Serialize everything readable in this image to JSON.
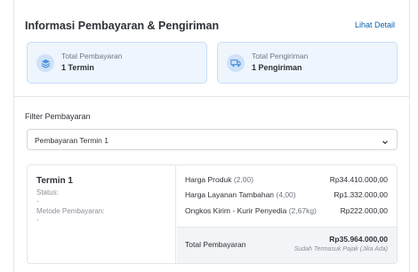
{
  "header": {
    "title": "Informasi Pembayaran & Pengiriman",
    "link": "Lihat Detail"
  },
  "summary": {
    "payment": {
      "label": "Total Pembayaran",
      "value": "1 Termin",
      "icon": "stack-icon"
    },
    "shipping": {
      "label": "Total Pengiriman",
      "value": "1 Pengiriman",
      "icon": "truck-icon"
    }
  },
  "filter": {
    "label": "Filter Pembayaran",
    "selected": "Pembayaran Termin 1"
  },
  "detail": {
    "termin_title": "Termin 1",
    "status_label": "Status:",
    "status_value": "-",
    "method_label": "Metode Pembayaran:",
    "method_value": "-",
    "lines": [
      {
        "label": "Harga Produk",
        "qty": "(2,00)",
        "amount": "Rp34.410.000,00"
      },
      {
        "label": "Harga Layanan Tambahan",
        "qty": "(4,00)",
        "amount": "Rp1.332.000,00"
      },
      {
        "label": "Ongkos Kirim - Kurir Penyedia",
        "qty": "(2,67kg)",
        "amount": "Rp222.000,00"
      }
    ],
    "total_label": "Total Pembayaran",
    "total_amount": "Rp35.964.000,00",
    "total_note": "Sudah Termasuk Pajak (Jika Ada)"
  },
  "colors": {
    "accent": "#0b5fb0",
    "summary_bg": "#eef5fd",
    "total_bg": "#f2f4f7"
  }
}
